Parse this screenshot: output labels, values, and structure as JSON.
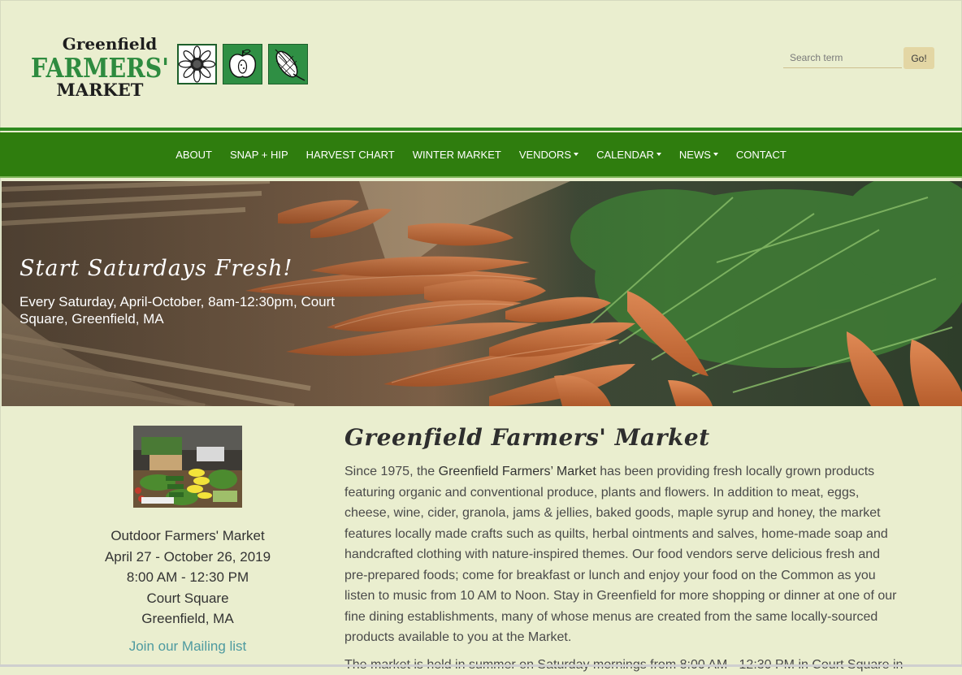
{
  "header": {
    "logo": {
      "line1": "Greenfield",
      "line2": "FARMERS'",
      "line3": "MARKET",
      "icons": [
        "sunflower-icon",
        "apple-icon",
        "corn-icon"
      ]
    },
    "search": {
      "placeholder": "Search term",
      "button_label": "Go!"
    }
  },
  "nav": {
    "items": [
      {
        "label": "ABOUT",
        "dropdown": false
      },
      {
        "label": "SNAP + HIP",
        "dropdown": false
      },
      {
        "label": "HARVEST CHART",
        "dropdown": false
      },
      {
        "label": "WINTER MARKET",
        "dropdown": false
      },
      {
        "label": "VENDORS",
        "dropdown": true
      },
      {
        "label": "CALENDAR",
        "dropdown": true
      },
      {
        "label": "NEWS",
        "dropdown": true
      },
      {
        "label": "CONTACT",
        "dropdown": false
      }
    ]
  },
  "hero": {
    "title": "Start Saturdays Fresh!",
    "subtitle": "Every Saturday, April-October, 8am-12:30pm, Court Square, Greenfield, MA"
  },
  "sidebar": {
    "info_lines": [
      "Outdoor Farmers' Market",
      "April 27 - October 26, 2019",
      "8:00 AM - 12:30 PM",
      "Court Square",
      "Greenfield, MA"
    ],
    "mailing_link": "Join our Mailing list"
  },
  "main": {
    "title": "Greenfield Farmers' Market",
    "para_prefix": "Since 1975, the ",
    "para_bold": "Greenfield Farmers’ Market",
    "para_rest": " has been providing fresh locally grown products featuring organic and conventional produce, plants and flowers. In addition to meat, eggs, cheese, wine, cider, granola, jams & jellies, baked goods, maple syrup and honey, the market features locally made crafts such as quilts, herbal ointments and salves, home-made soap and handcrafted clothing with nature-inspired themes. Our food vendors serve delicious fresh and pre-prepared foods; come for breakfast or lunch and enjoy your food on the Common as you listen to music from 10 AM to Noon. Stay in Greenfield for more shopping or dinner at one of our fine dining establishments, many of whose menus are created from the same locally-sourced products available to you at the Market.",
    "para2": "The market is held in summer on Saturday mornings from 8:00 AM - 12:30 PM in Court Square in"
  },
  "colors": {
    "page_bg": "#eaeecf",
    "nav_bg": "#2f7d0e",
    "logo_green": "#2e8b3f",
    "link_teal": "#4e9aa0",
    "search_button": "#e3d6a4"
  }
}
